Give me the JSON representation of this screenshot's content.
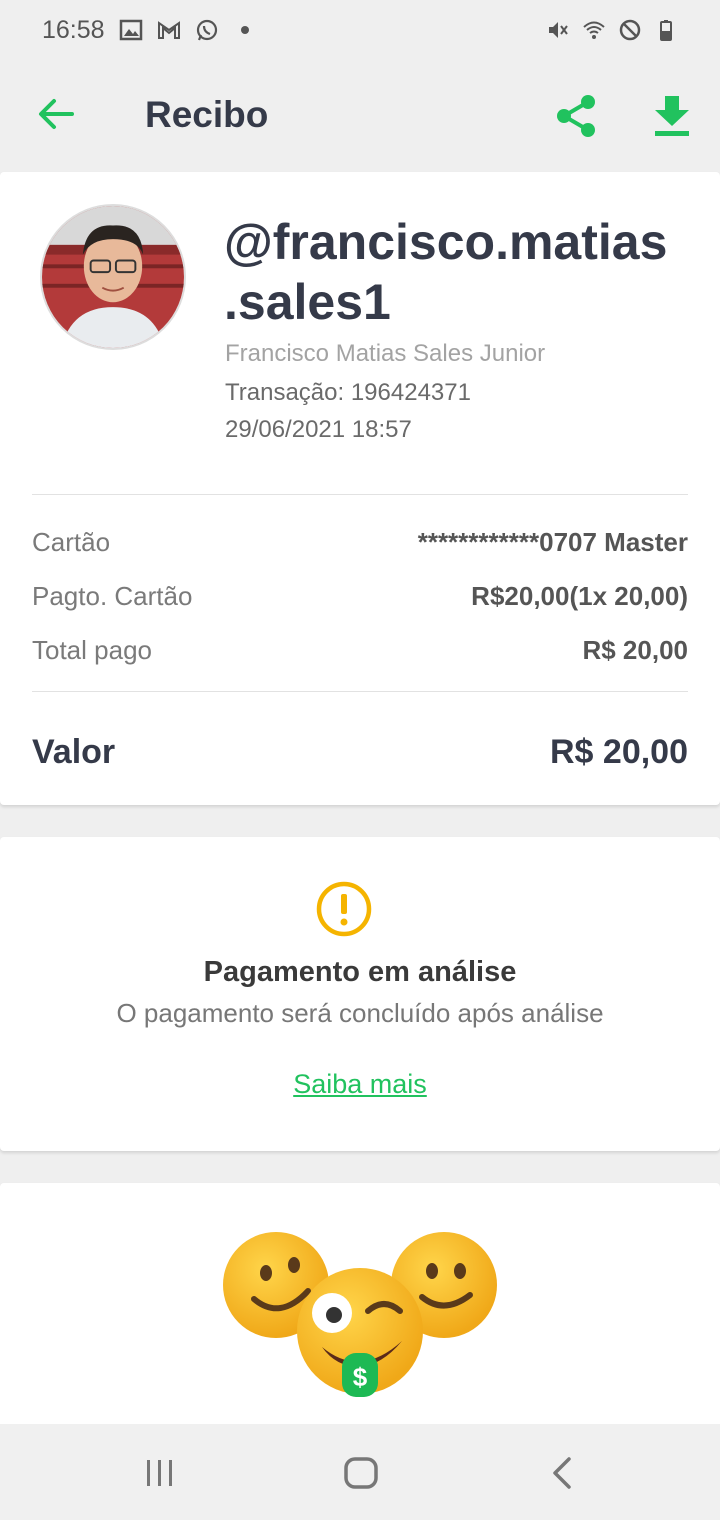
{
  "status_bar": {
    "time": "16:58",
    "left_icons": [
      "image-icon",
      "gmail-icon",
      "whatsapp-icon",
      "dot-icon"
    ],
    "right_icons": [
      "mute-icon",
      "wifi-icon",
      "dnd-icon",
      "battery-icon"
    ]
  },
  "app_bar": {
    "title": "Recibo",
    "accent_color": "#21c25e"
  },
  "receipt": {
    "username_line1": "@francisco.matias",
    "username_line2": ".sales1",
    "full_name": "Francisco Matias Sales Junior",
    "transaction": "Transação: 196424371",
    "datetime": "29/06/2021 18:57",
    "rows": [
      {
        "label": "Cartão",
        "value": "************0707 Master"
      },
      {
        "label": "Pagto. Cartão",
        "value": "R$20,00(1x 20,00)"
      },
      {
        "label": "Total pago",
        "value": "R$ 20,00"
      }
    ],
    "total": {
      "label": "Valor",
      "value": "R$ 20,00"
    }
  },
  "analysis": {
    "title": "Pagamento em análise",
    "subtitle": "O pagamento será concluído após análise",
    "link": "Saiba mais",
    "warning_color": "#f5b400"
  },
  "nav_bar": {
    "icons": [
      "recent-apps-icon",
      "home-icon",
      "back-icon"
    ]
  }
}
